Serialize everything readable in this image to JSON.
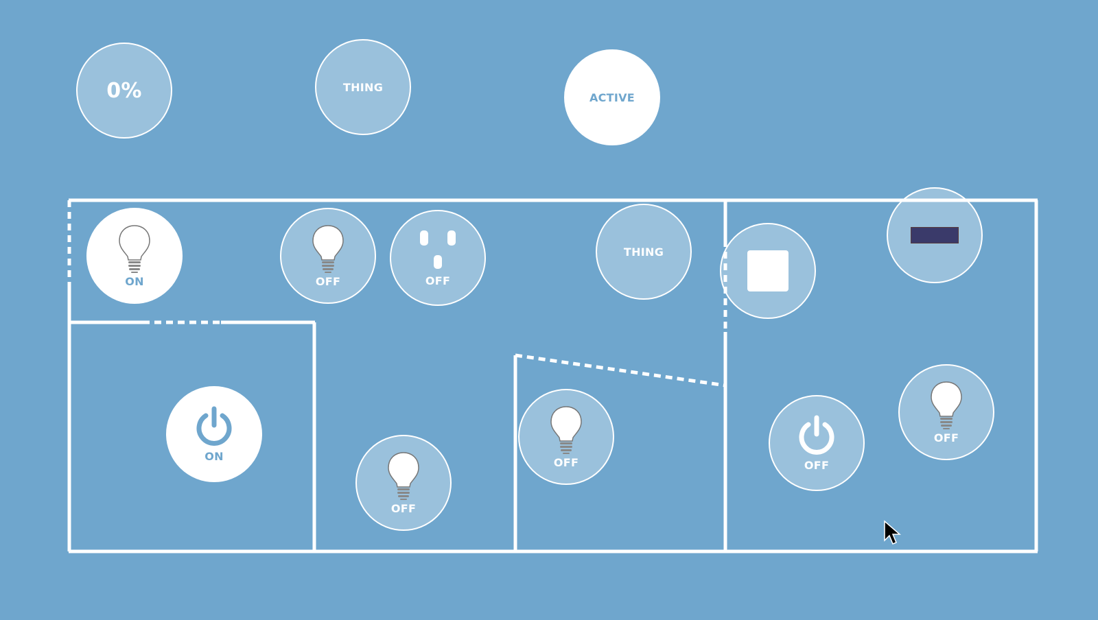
{
  "theme": {
    "background": "#6fa6cd",
    "accent": "#ffffff",
    "tile_fill": "rgba(255,255,255,0.3)"
  },
  "tiles": {
    "percent": {
      "label": "0%",
      "state": "inactive"
    },
    "thing_top": {
      "label": "THING",
      "state": "inactive"
    },
    "active_top": {
      "label": "ACTIVE",
      "state": "active"
    },
    "light_1": {
      "label": "ON",
      "icon": "lightbulb-icon",
      "state": "active"
    },
    "light_2": {
      "label": "OFF",
      "icon": "lightbulb-icon",
      "state": "inactive"
    },
    "outlet_1": {
      "label": "OFF",
      "icon": "outlet-icon",
      "state": "inactive"
    },
    "thing_room": {
      "label": "THING",
      "state": "inactive"
    },
    "stop_tile": {
      "icon": "stop-square-icon",
      "state": "inactive"
    },
    "media_tile": {
      "icon": "media-thumbnail-icon",
      "state": "inactive"
    },
    "power_1": {
      "label": "ON",
      "icon": "power-icon",
      "state": "active"
    },
    "light_3": {
      "label": "OFF",
      "icon": "lightbulb-icon",
      "state": "inactive"
    },
    "light_4": {
      "label": "OFF",
      "icon": "lightbulb-icon",
      "state": "inactive"
    },
    "power_2": {
      "label": "OFF",
      "icon": "power-icon",
      "state": "inactive"
    },
    "light_5": {
      "label": "OFF",
      "icon": "lightbulb-icon",
      "state": "inactive"
    }
  }
}
